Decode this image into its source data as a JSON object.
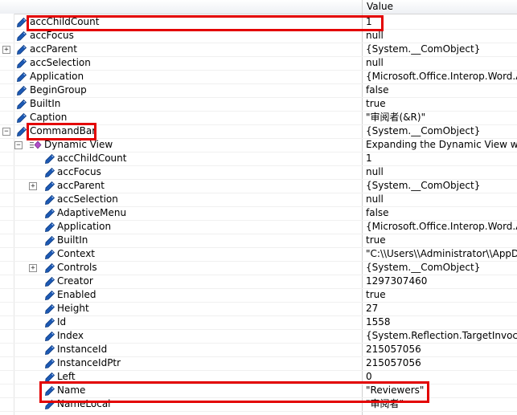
{
  "header": {
    "value_column": "Value"
  },
  "rows": [
    {
      "name": "accChildCount",
      "value": "1"
    },
    {
      "name": "accFocus",
      "value": "null"
    },
    {
      "name": "accParent",
      "value": "{System.__ComObject}"
    },
    {
      "name": "accSelection",
      "value": "null"
    },
    {
      "name": "Application",
      "value": "{Microsoft.Office.Interop.Word.Application}"
    },
    {
      "name": "BeginGroup",
      "value": "false"
    },
    {
      "name": "BuiltIn",
      "value": "true"
    },
    {
      "name": "Caption",
      "value": "\"审阅者(&R)\""
    },
    {
      "name": "CommandBar",
      "value": "{System.__ComObject}"
    },
    {
      "name": "Dynamic View",
      "value": "Expanding the Dynamic View will get the COM members"
    },
    {
      "name": "accChildCount",
      "value": "1"
    },
    {
      "name": "accFocus",
      "value": "null"
    },
    {
      "name": "accParent",
      "value": "{System.__ComObject}"
    },
    {
      "name": "accSelection",
      "value": "null"
    },
    {
      "name": "AdaptiveMenu",
      "value": "false"
    },
    {
      "name": "Application",
      "value": "{Microsoft.Office.Interop.Word.Application}"
    },
    {
      "name": "BuiltIn",
      "value": "true"
    },
    {
      "name": "Context",
      "value": "\"C:\\\\Users\\\\Administrator\\\\AppData"
    },
    {
      "name": "Controls",
      "value": "{System.__ComObject}"
    },
    {
      "name": "Creator",
      "value": "1297307460"
    },
    {
      "name": "Enabled",
      "value": "true"
    },
    {
      "name": "Height",
      "value": "27"
    },
    {
      "name": "Id",
      "value": "1558"
    },
    {
      "name": "Index",
      "value": "{System.Reflection.TargetInvocationException}"
    },
    {
      "name": "InstanceId",
      "value": "215057056"
    },
    {
      "name": "InstanceIdPtr",
      "value": "215057056"
    },
    {
      "name": "Left",
      "value": "0"
    },
    {
      "name": "Name",
      "value": "\"Reviewers\""
    },
    {
      "name": "NameLocal",
      "value": "\"审阅者\""
    }
  ],
  "colors": {
    "highlight": "#e30000",
    "icon": "#1d5ab5"
  },
  "icons": {
    "property": "property-icon",
    "dynamic_view": "dynamic-view-icon",
    "expand": "expand-icon",
    "collapse": "collapse-icon"
  }
}
